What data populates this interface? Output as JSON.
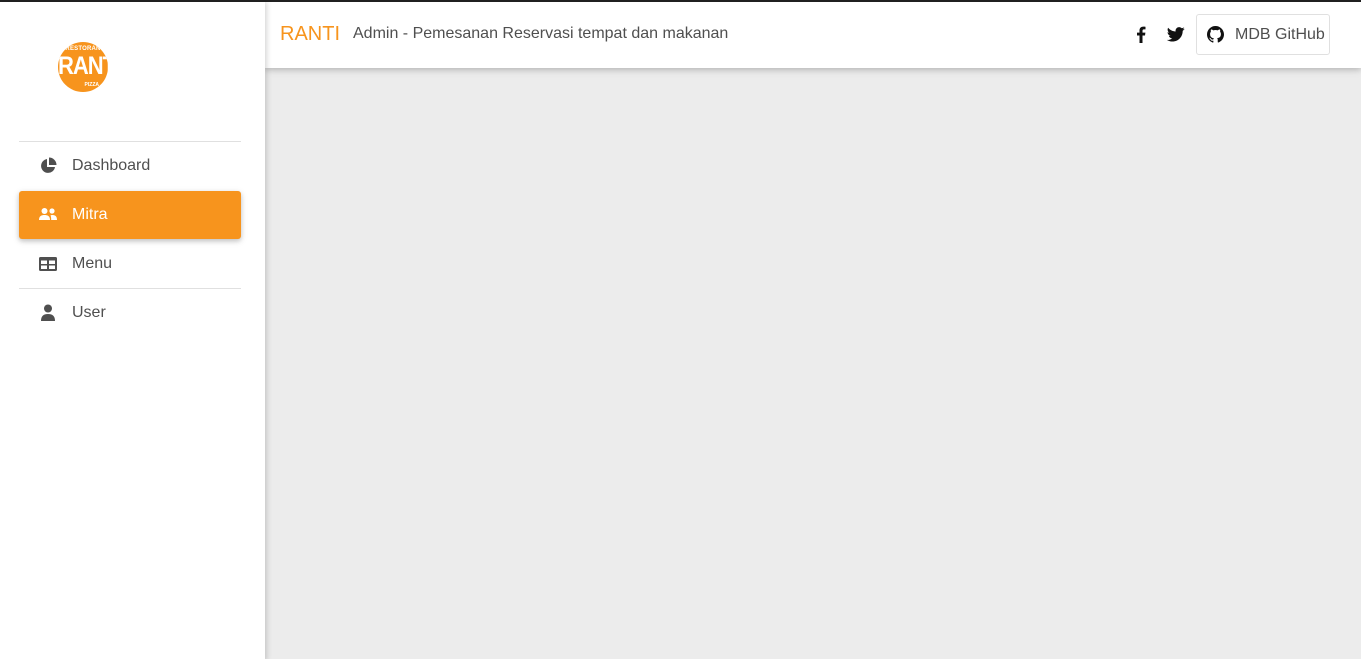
{
  "app": {
    "logo": {
      "main": "RANTI",
      "top": "RESTORAN",
      "bottom": "PIZZA"
    }
  },
  "sidebar": {
    "items": [
      {
        "label": "Dashboard",
        "icon": "chart-pie-icon"
      },
      {
        "label": "Mitra",
        "icon": "users-icon",
        "active": true
      },
      {
        "label": "Menu",
        "icon": "table-icon"
      },
      {
        "label": "User",
        "icon": "user-icon"
      }
    ]
  },
  "header": {
    "brand": "RANTI",
    "subtitle": "Admin - Pemesanan Reservasi tempat dan makanan",
    "social": [
      "facebook-icon",
      "twitter-icon"
    ],
    "github_label": "MDB GitHub"
  },
  "colors": {
    "accent": "#f7941d",
    "text": "#4f4f4f",
    "background": "#ececec"
  }
}
